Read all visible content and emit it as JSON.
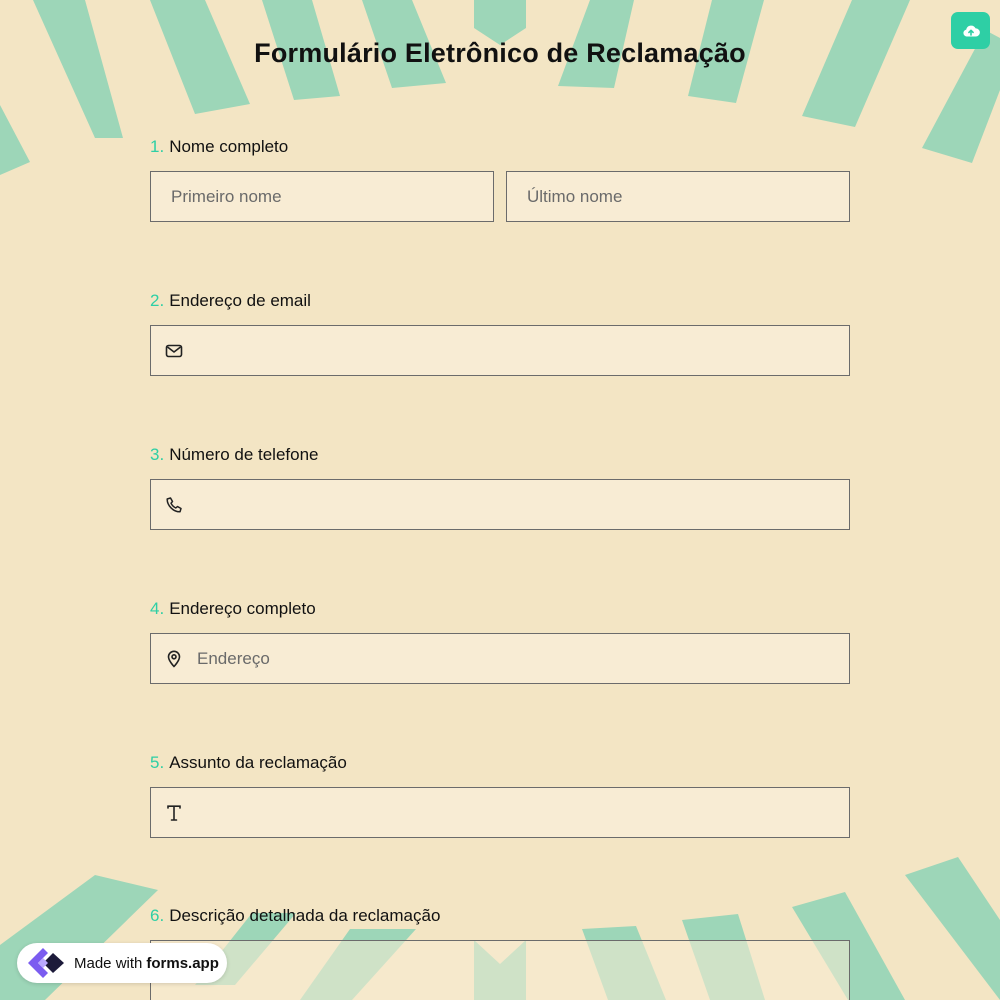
{
  "form": {
    "title": "Formulário Eletrônico de Reclamação"
  },
  "questions": [
    {
      "number": "1.",
      "label": "Nome completo",
      "placeholders": [
        "Primeiro nome",
        "Último nome"
      ]
    },
    {
      "number": "2.",
      "label": "Endereço de email",
      "icon": "mail-icon",
      "placeholder": ""
    },
    {
      "number": "3.",
      "label": "Número de telefone",
      "icon": "phone-icon",
      "placeholder": ""
    },
    {
      "number": "4.",
      "label": "Endereço completo",
      "icon": "location-pin-icon",
      "placeholder": "Endereço"
    },
    {
      "number": "5.",
      "label": "Assunto da reclamação",
      "icon": "text-type-icon",
      "placeholder": ""
    },
    {
      "number": "6.",
      "label": "Descrição detalhada da reclamação",
      "placeholder": ""
    }
  ],
  "badge": {
    "prefix": "Made with",
    "brand": "forms.app"
  },
  "theme": {
    "background": "#f3e5c4",
    "accent": "#2ecfa5",
    "stripe": "#9dd6b8",
    "field_bg": "#f8ecd4"
  }
}
